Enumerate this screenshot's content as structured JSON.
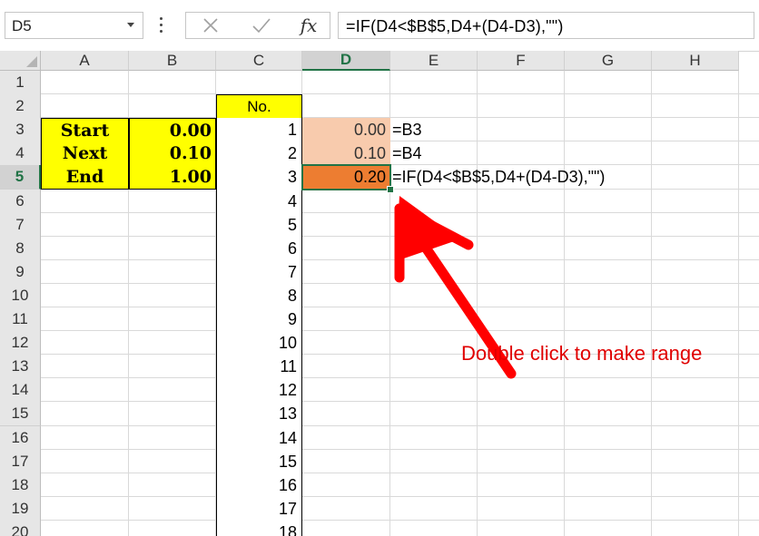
{
  "formula_bar": {
    "name_box": "D5",
    "formula": "=IF(D4<$B$5,D4+(D4-D3),\"\")",
    "fx_label": "fx"
  },
  "columns": [
    "A",
    "B",
    "C",
    "D",
    "E",
    "F",
    "G",
    "H"
  ],
  "rows": [
    "1",
    "2",
    "3",
    "4",
    "5",
    "6",
    "7",
    "8",
    "9",
    "10",
    "11",
    "12",
    "13",
    "14",
    "15",
    "16",
    "17",
    "18",
    "19",
    "20"
  ],
  "params": {
    "start_label": "Start",
    "start_value": "0.00",
    "next_label": "Next",
    "next_value": "0.10",
    "end_label": "End",
    "end_value": "1.00"
  },
  "no_header": "No.",
  "no_values": [
    "1",
    "2",
    "3",
    "4",
    "5",
    "6",
    "7",
    "8",
    "9",
    "10",
    "11",
    "12",
    "13",
    "14",
    "15",
    "16",
    "17",
    "18"
  ],
  "d_values": [
    "0.00",
    "0.10",
    "0.20"
  ],
  "formula_notes": [
    "=B3",
    "=B4",
    "=IF(D4<$B$5,D4+(D4-D3),\"\")"
  ],
  "annotation": "Double click to make range",
  "colors": {
    "arrow": "#ff0000",
    "selection": "#217346",
    "highlight": "#ffff00",
    "orange_light": "#f8cbad",
    "orange_dark": "#ed7d31"
  }
}
